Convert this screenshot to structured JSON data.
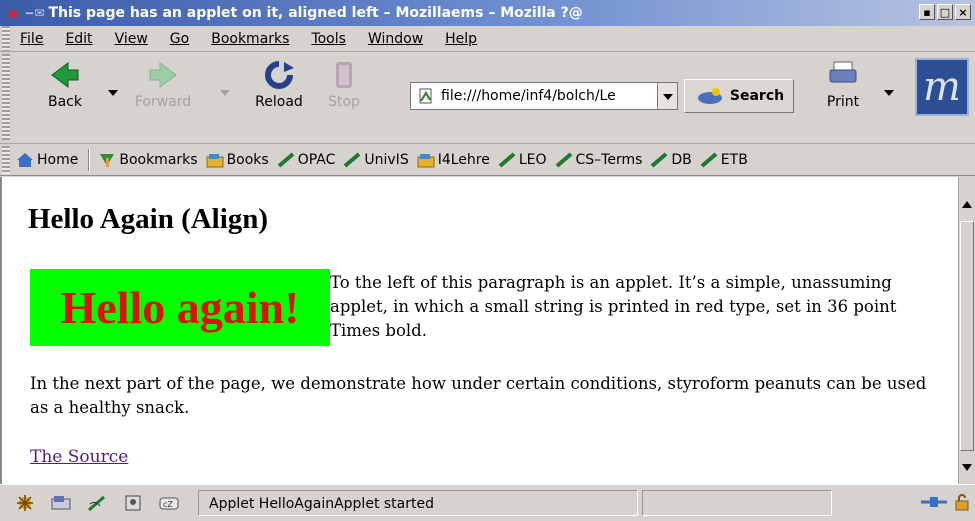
{
  "window": {
    "title": "This page has an applet on it, aligned left – Mozillaems – Mozilla ?@"
  },
  "menu": {
    "items": [
      "File",
      "Edit",
      "View",
      "Go",
      "Bookmarks",
      "Tools",
      "Window",
      "Help"
    ]
  },
  "navbar": {
    "back_label": "Back",
    "forward_label": "Forward",
    "reload_label": "Reload",
    "stop_label": "Stop",
    "url_value": "file:///home/inf4/bolch/Le",
    "search_label": "Search",
    "print_label": "Print",
    "logo_text": "m"
  },
  "bookmarks_bar": {
    "items": [
      {
        "label": "Home",
        "icon": "home-icon"
      },
      {
        "label": "Bookmarks",
        "icon": "bookmarks-icon"
      },
      {
        "label": "Books",
        "icon": "folder-icon"
      },
      {
        "label": "OPAC",
        "icon": "bookmark-link-icon"
      },
      {
        "label": "UnivIS",
        "icon": "bookmark-link-icon"
      },
      {
        "label": "I4Lehre",
        "icon": "folder-icon"
      },
      {
        "label": "LEO",
        "icon": "bookmark-link-icon"
      },
      {
        "label": "CS–Terms",
        "icon": "bookmark-link-icon"
      },
      {
        "label": "DB",
        "icon": "bookmark-link-icon"
      },
      {
        "label": "ETB",
        "icon": "bookmark-link-icon"
      }
    ]
  },
  "page": {
    "heading": "Hello Again (Align)",
    "applet_text": "Hello again!",
    "paragraph1": "To the left of this paragraph is an applet. It’s a simple, unassuming applet, in which a small string is printed in red type, set in 36 point Times bold.",
    "paragraph2": "In the next part of the page, we demonstrate how under certain conditions, styroform peanuts can be used as a healthy snack.",
    "source_link": "The Source"
  },
  "statusbar": {
    "text": "Applet HelloAgainApplet started"
  },
  "colors": {
    "applet_bg": "#00ff00",
    "applet_text": "#e01010",
    "visited_link": "#551a8b"
  }
}
